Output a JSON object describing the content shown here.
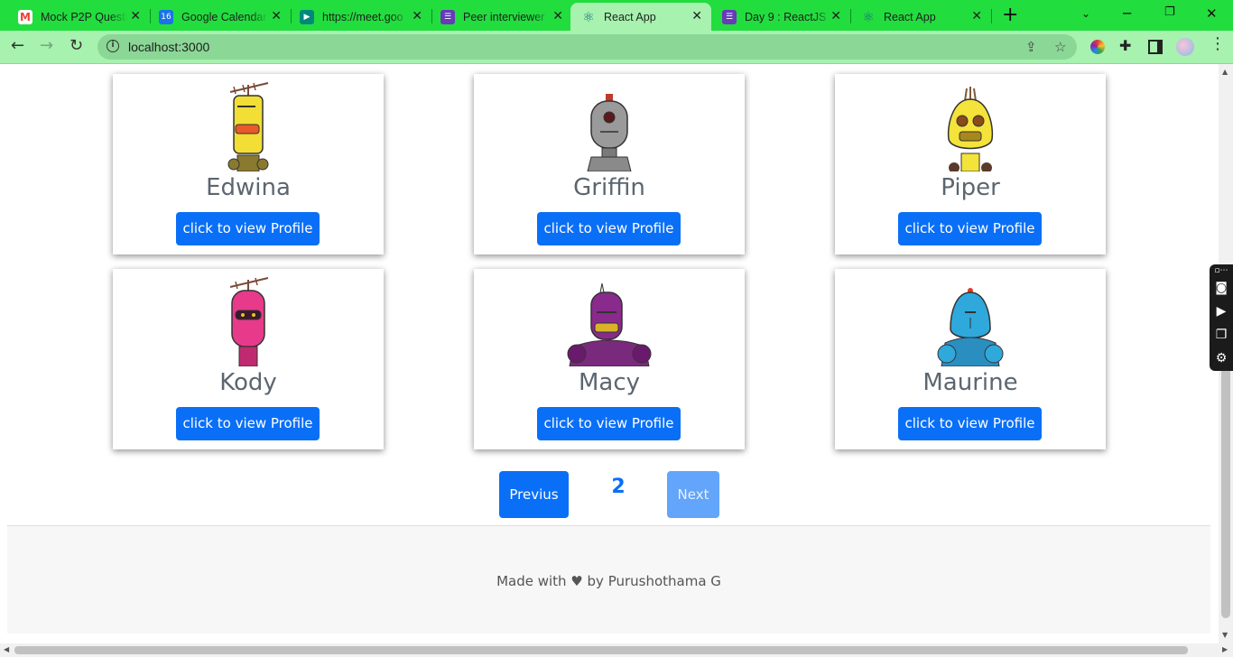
{
  "browser": {
    "tabs": [
      {
        "title": "Mock P2P Questi",
        "favicon": "gmail-icon",
        "color": "#ea4335",
        "active": false
      },
      {
        "title": "Google Calendar",
        "favicon": "calendar-icon",
        "color": "#1a73e8",
        "active": false
      },
      {
        "title": "https://meet.goo",
        "favicon": "meet-icon",
        "color": "#00897b",
        "active": false
      },
      {
        "title": "Peer interviewer",
        "favicon": "form-icon",
        "color": "#673ab7",
        "active": false
      },
      {
        "title": "React App",
        "favicon": "react-icon",
        "color": "#61dafb",
        "active": true
      },
      {
        "title": "Day 9 : ReactJS",
        "favicon": "form-icon",
        "color": "#673ab7",
        "active": false
      },
      {
        "title": "React App",
        "favicon": "react-icon",
        "color": "#61dafb",
        "active": false
      }
    ],
    "url": "localhost:3000"
  },
  "cards": [
    {
      "name": "Edwina",
      "button": "click to view Profile",
      "robot_color": "#f2de35",
      "icon": "robot-avatar"
    },
    {
      "name": "Griffin",
      "button": "click to view Profile",
      "robot_color": "#9a9a9a",
      "icon": "robot-avatar"
    },
    {
      "name": "Piper",
      "button": "click to view Profile",
      "robot_color": "#f4e33a",
      "icon": "robot-avatar"
    },
    {
      "name": "Kody",
      "button": "click to view Profile",
      "robot_color": "#e83a8b",
      "icon": "robot-avatar"
    },
    {
      "name": "Macy",
      "button": "click to view Profile",
      "robot_color": "#8a2a8c",
      "icon": "robot-avatar"
    },
    {
      "name": "Maurine",
      "button": "click to view Profile",
      "robot_color": "#2fa8db",
      "icon": "robot-avatar"
    }
  ],
  "pagination": {
    "previous": "Previus",
    "current": "2",
    "next": "Next"
  },
  "footer": {
    "text": "Made with ♥ by Purushothama G"
  },
  "colors": {
    "primary": "#0a6ff7",
    "disabled": "#62a5fa",
    "tabstrip": "#22dd3e",
    "toolbar": "#a6f2ae"
  }
}
